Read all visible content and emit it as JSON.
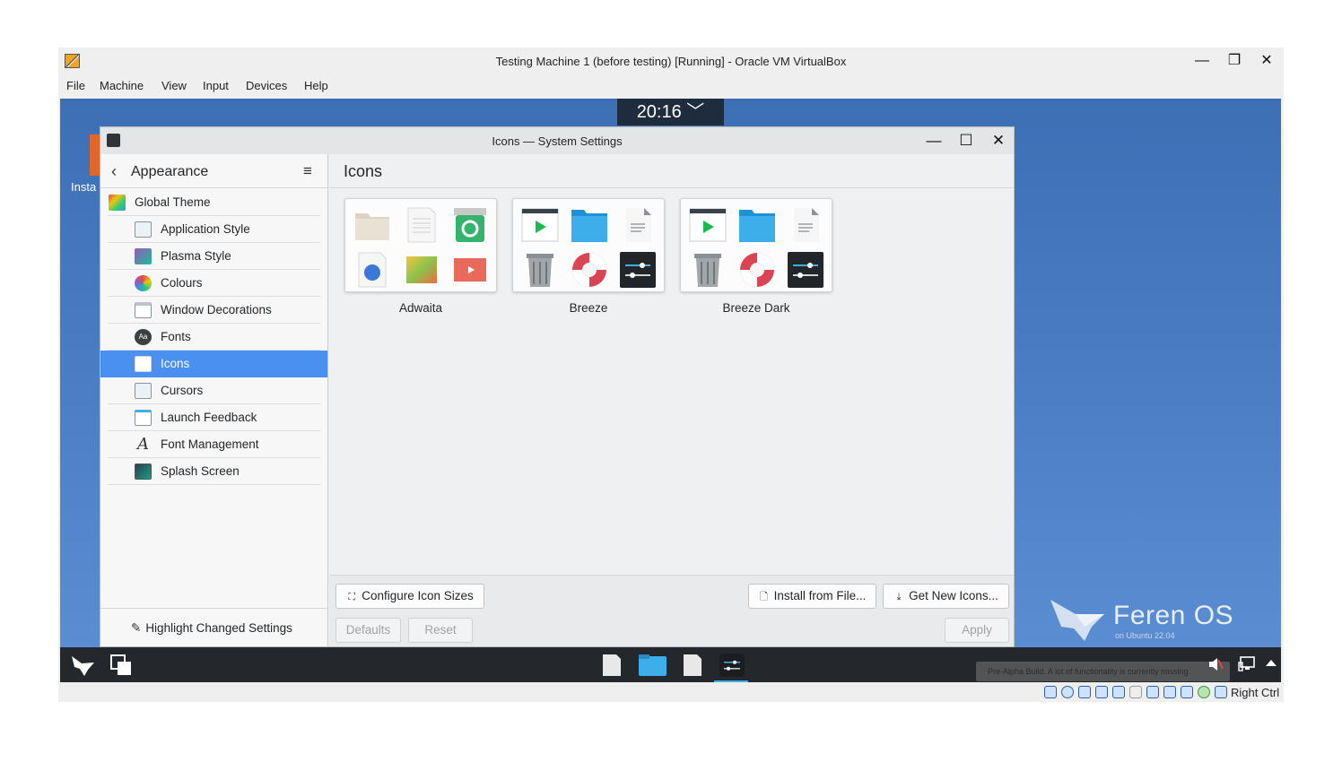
{
  "vbox": {
    "title": "Testing Machine 1 (before testing) [Running] - Oracle VM VirtualBox",
    "menu": [
      "File",
      "Machine",
      "View",
      "Input",
      "Devices",
      "Help"
    ],
    "controls": {
      "minimize": "—",
      "maximize": "❐",
      "close": "✕"
    },
    "status_right": "Right Ctrl"
  },
  "desktop": {
    "clock": "20:16 ﹀",
    "icon_label": "Insta",
    "brand_name": "Feren OS",
    "brand_sub": "on Ubuntu 22.04"
  },
  "taskbar": {
    "notice": "Pre-Alpha Build. A lot of functionality is currently missing."
  },
  "settings": {
    "window_title": "Icons — System Settings",
    "sidebar_title": "Appearance",
    "sidebar_items": [
      {
        "label": "Global Theme",
        "icon": "global-theme-icon"
      },
      {
        "label": "Application Style",
        "icon": "application-style-icon"
      },
      {
        "label": "Plasma Style",
        "icon": "plasma-style-icon"
      },
      {
        "label": "Colours",
        "icon": "colours-icon"
      },
      {
        "label": "Window Decorations",
        "icon": "window-decorations-icon"
      },
      {
        "label": "Fonts",
        "icon": "fonts-icon"
      },
      {
        "label": "Icons",
        "icon": "icons-icon",
        "selected": true
      },
      {
        "label": "Cursors",
        "icon": "cursors-icon"
      },
      {
        "label": "Launch Feedback",
        "icon": "launch-feedback-icon"
      },
      {
        "label": "Font Management",
        "icon": "font-management-icon"
      },
      {
        "label": "Splash Screen",
        "icon": "splash-screen-icon"
      }
    ],
    "highlight_button": "Highlight Changed Settings",
    "page_title": "Icons",
    "themes": [
      "Adwaita",
      "Breeze",
      "Breeze Dark"
    ],
    "buttons": {
      "configure_sizes": "Configure Icon Sizes",
      "install_from_file": "Install from File...",
      "get_new": "Get New Icons...",
      "defaults": "Defaults",
      "reset": "Reset",
      "apply": "Apply"
    },
    "colors": {
      "selection": "#4a90f0",
      "breeze_blue": "#3daee9"
    }
  }
}
